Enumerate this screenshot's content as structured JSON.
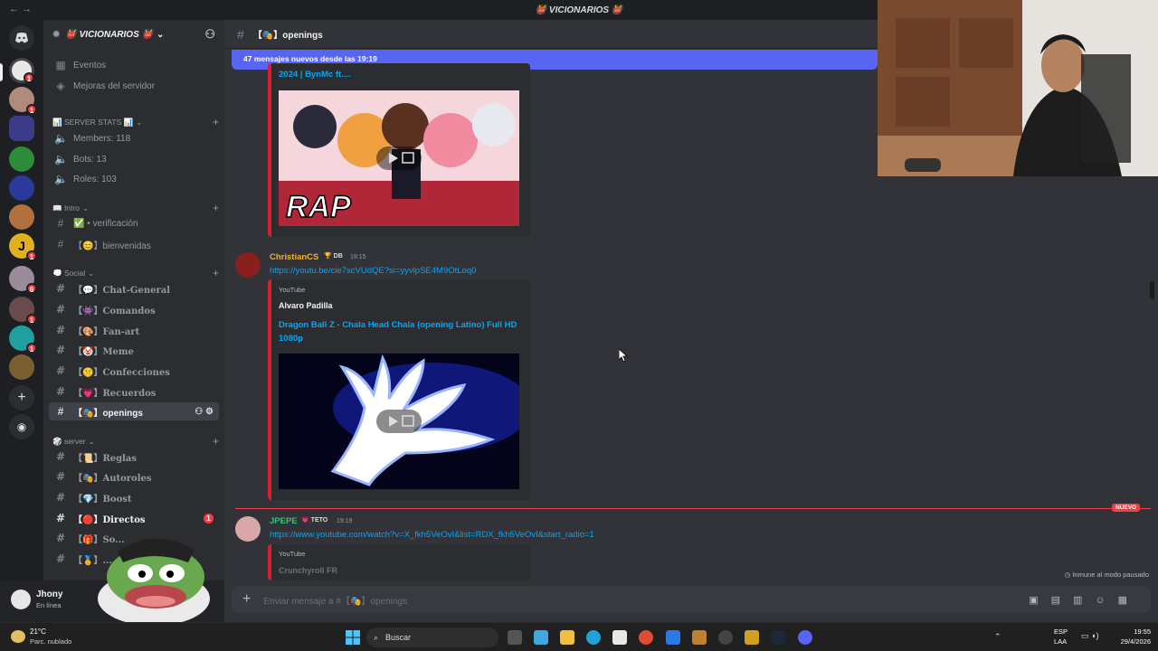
{
  "window": {
    "title": "👹 VICIONARIOS 👹"
  },
  "server": {
    "name": "👹 VICIONARIOS 👹"
  },
  "sidebar": {
    "top_items": [
      {
        "label": "Eventos",
        "icon": "calendar-icon"
      },
      {
        "label": "Mejoras del servidor",
        "icon": "boost-icon"
      }
    ],
    "categories": [
      {
        "label": "📊 SERVER STATS 📊"
      },
      {
        "label": "📖 Intro"
      },
      {
        "label": "💭 Social"
      },
      {
        "label": "🎲 server"
      }
    ],
    "stats": [
      {
        "label": "Members: 118"
      },
      {
        "label": "Bots: 13"
      },
      {
        "label": "Roles: 103"
      }
    ],
    "intro": [
      {
        "label": "✅ • verificación"
      },
      {
        "label": "【😊】bienvenidas"
      }
    ],
    "social": [
      {
        "label": "【💬】Chat-General"
      },
      {
        "label": "【👾】Comandos"
      },
      {
        "label": "【🎨】Fan-art"
      },
      {
        "label": "【🤡】Meme"
      },
      {
        "label": "【🤫】Confecciones"
      },
      {
        "label": "【💗】Recuerdos"
      },
      {
        "label": "【🎭】openings"
      }
    ],
    "server_ch": [
      {
        "label": "【📜】Reglas"
      },
      {
        "label": "【🎭】Autoroles"
      },
      {
        "label": "【💎】Boost"
      },
      {
        "label": "【🔴】Directos",
        "badge": "1"
      },
      {
        "label": "【🎁】So..."
      },
      {
        "label": "【🏅】..."
      }
    ]
  },
  "user": {
    "name": "Jhony",
    "status": "En línea"
  },
  "channel": {
    "name": "【🎭】openings"
  },
  "new_messages_bar": "47 mensajes nuevos desde las 19:19",
  "messages": [
    {
      "embed_top_title": "2024 | BynMc ft....",
      "thumbnail_text": "RAP"
    },
    {
      "author": "ChristianCS",
      "tag": "DB",
      "time": "19:15",
      "link": "https://youtu.be/cie7scVUdQE?si=yyvlpSE4M9OtLoq0",
      "provider": "YouTube",
      "embed_author": "Alvaro Padilla",
      "embed_title": "Dragon Ball Z - Chala Head Chala (opening Latino) Full HD 1080p"
    },
    {
      "author": "JPEPE",
      "tag": "TETO",
      "time": "19:19",
      "link": "https://www.youtube.com/watch?v=X_fkh5VeOvI&list=RDX_fkh5VeOvI&start_radio=1",
      "provider": "YouTube",
      "embed_author": "Crunchyroll FR"
    }
  ],
  "new_divider": "NUEVO",
  "slowmode_note": "Inmune al modo pausado",
  "composer": {
    "placeholder": "Enviar mensaje a #【🎭】openings"
  },
  "taskbar": {
    "weather_temp": "21°C",
    "weather_desc": "Parc. nublado",
    "search": "Buscar",
    "lang1": "ESP",
    "lang2": "LAA",
    "time": "19:55",
    "date": "29/4/2026"
  },
  "colors": {
    "accent": "#5865f2",
    "link": "#00a8fc",
    "danger": "#f23f43",
    "embed_border": "#d8202b"
  }
}
